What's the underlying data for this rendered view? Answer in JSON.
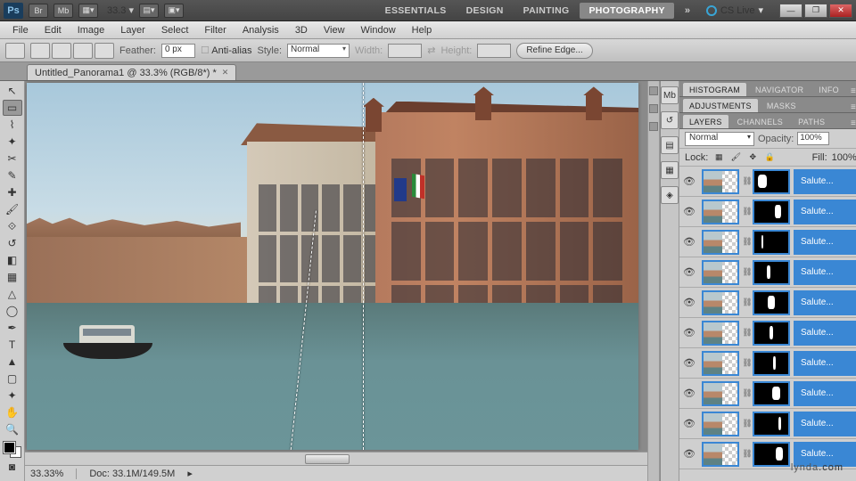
{
  "titlebar": {
    "logo": "Ps",
    "zoom": "33.3",
    "workspaces": [
      "ESSENTIALS",
      "DESIGN",
      "PAINTING",
      "PHOTOGRAPHY"
    ],
    "active_workspace": 3,
    "cslive": "CS Live"
  },
  "menus": [
    "File",
    "Edit",
    "Image",
    "Layer",
    "Select",
    "Filter",
    "Analysis",
    "3D",
    "View",
    "Window",
    "Help"
  ],
  "options": {
    "feather_label": "Feather:",
    "feather_value": "0 px",
    "antialias": "Anti-alias",
    "style_label": "Style:",
    "style_value": "Normal",
    "width_label": "Width:",
    "height_label": "Height:",
    "refine": "Refine Edge..."
  },
  "doc_tab": "Untitled_Panorama1 @ 33.3% (RGB/8*) *",
  "status": {
    "zoom": "33.33%",
    "doc": "Doc: 33.1M/149.5M"
  },
  "panels": {
    "group1": [
      "HISTOGRAM",
      "NAVIGATOR",
      "INFO"
    ],
    "group2": [
      "ADJUSTMENTS",
      "MASKS"
    ],
    "group3": [
      "LAYERS",
      "CHANNELS",
      "PATHS"
    ]
  },
  "layers_panel": {
    "blend": "Normal",
    "opacity_label": "Opacity:",
    "opacity": "100%",
    "lock_label": "Lock:",
    "fill_label": "Fill:",
    "fill": "100%",
    "rows": [
      {
        "name": "Salute...",
        "mask_w": "28%",
        "mask_l": "10%"
      },
      {
        "name": "Salute...",
        "mask_w": "18%",
        "mask_l": "60%"
      },
      {
        "name": "Salute...",
        "mask_w": "6%",
        "mask_l": "20%"
      },
      {
        "name": "Salute...",
        "mask_w": "10%",
        "mask_l": "38%"
      },
      {
        "name": "Salute...",
        "mask_w": "20%",
        "mask_l": "40%"
      },
      {
        "name": "Salute...",
        "mask_w": "12%",
        "mask_l": "44%"
      },
      {
        "name": "Salute...",
        "mask_w": "8%",
        "mask_l": "55%"
      },
      {
        "name": "Salute...",
        "mask_w": "24%",
        "mask_l": "52%"
      },
      {
        "name": "Salute...",
        "mask_w": "10%",
        "mask_l": "70%"
      },
      {
        "name": "Salute...",
        "mask_w": "22%",
        "mask_l": "62%"
      }
    ]
  },
  "watermark": {
    "a": "lynda",
    "b": ".com"
  }
}
